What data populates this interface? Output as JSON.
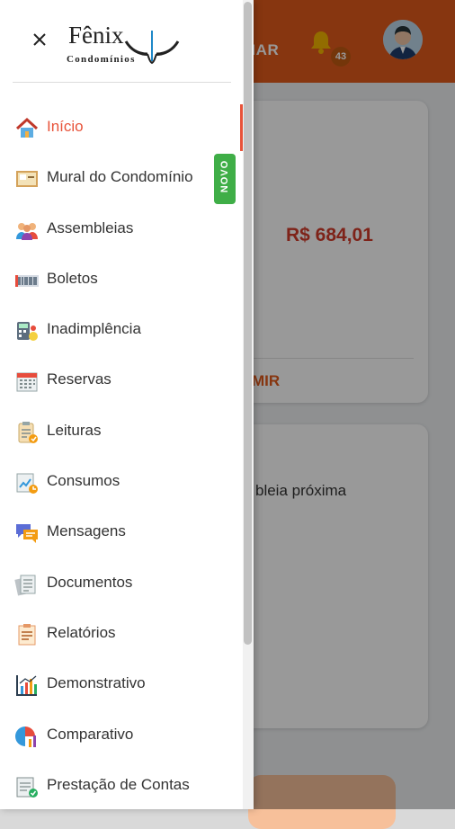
{
  "background": {
    "header_text": "MAR",
    "notification_count": "43",
    "amount": "R$ 684,01",
    "card_action": "MIR",
    "card2_text": "bleia próxima"
  },
  "drawer": {
    "logo": {
      "name": "Fênix",
      "subtitle": "Condomínios"
    },
    "badge_new": "NOVO",
    "items": [
      {
        "label": "Início",
        "icon": "home-icon",
        "active": true
      },
      {
        "label": "Mural do Condomínio",
        "icon": "bulletin-board-icon"
      },
      {
        "label": "Assembleias",
        "icon": "people-meeting-icon"
      },
      {
        "label": "Boletos",
        "icon": "barcode-icon"
      },
      {
        "label": "Inadimplência",
        "icon": "debt-calculator-icon"
      },
      {
        "label": "Reservas",
        "icon": "calendar-icon"
      },
      {
        "label": "Leituras",
        "icon": "clipboard-reading-icon"
      },
      {
        "label": "Consumos",
        "icon": "consumption-chart-icon"
      },
      {
        "label": "Mensagens",
        "icon": "chat-bubbles-icon"
      },
      {
        "label": "Documentos",
        "icon": "documents-icon"
      },
      {
        "label": "Relatórios",
        "icon": "report-icon"
      },
      {
        "label": "Demonstrativo",
        "icon": "bar-chart-icon"
      },
      {
        "label": "Comparativo",
        "icon": "comparison-chart-icon"
      },
      {
        "label": "Prestação de Contas",
        "icon": "accountability-icon"
      }
    ]
  },
  "colors": {
    "accent": "#e8533a",
    "header": "#e25a1c",
    "badge_green": "#3fae47"
  }
}
